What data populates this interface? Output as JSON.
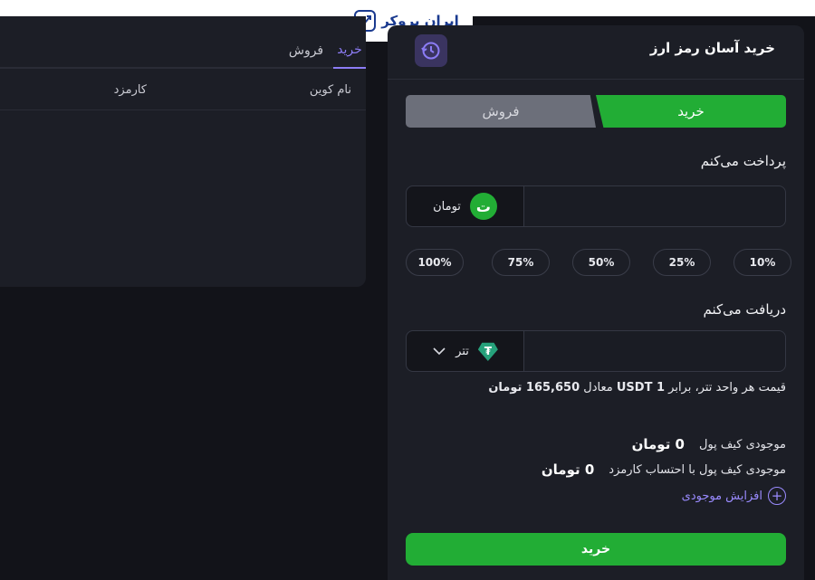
{
  "brand": {
    "logo_text": "ایران بروکر"
  },
  "orders": {
    "tabs": [
      {
        "label": "خرید"
      },
      {
        "label": "فروش"
      }
    ],
    "columns": {
      "coin": "نام کوین",
      "fee": "کارمزد"
    }
  },
  "panel": {
    "title": "خرید آسان رمز ارز",
    "segments": {
      "buy": "خرید",
      "sell": "فروش"
    },
    "pay": {
      "label": "پرداخت می‌کنم",
      "currency": "تومان",
      "currency_icon": "ت",
      "value": ""
    },
    "percents": [
      "10%",
      "25%",
      "50%",
      "75%",
      "100%"
    ],
    "receive": {
      "label": "دریافت می‌کنم",
      "currency": "تتر",
      "currency_icon": "₮",
      "value": ""
    },
    "rate": {
      "prefix": "قیمت هر واحد تتر، برابر",
      "unit": "1 USDT",
      "middle": "معادل",
      "amount": "165,650 تومان"
    },
    "balance": {
      "label": "موجودی کیف پول",
      "value": "0 تومان"
    },
    "balance_fee": {
      "label": "موجودی کیف پول با احتساب کارمزد",
      "value": "0 تومان"
    },
    "topup_label": "افزایش موجودی",
    "submit_label": "خرید"
  },
  "colors": {
    "accent": "#22ad35",
    "purple": "#8c7cf5",
    "panel": "#1c1e26",
    "background": "#121319"
  },
  "icons": {
    "history": "history-clock-icon",
    "chevron": "chevron-down-icon",
    "plus": "plus-circle-icon"
  }
}
